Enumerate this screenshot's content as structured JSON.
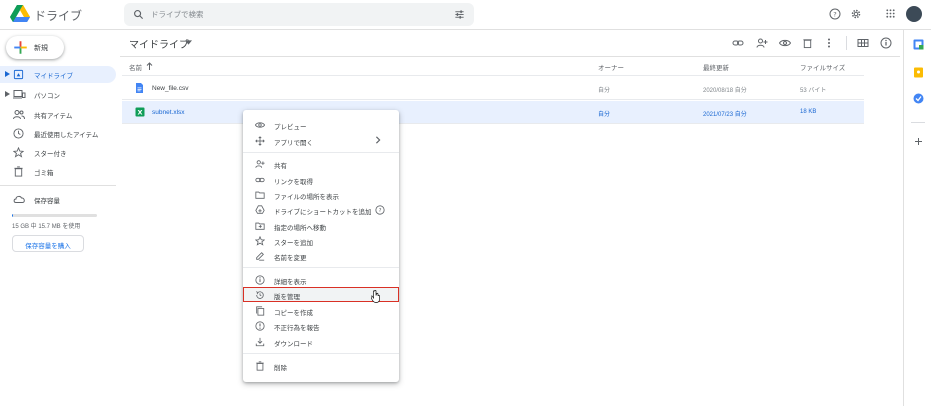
{
  "header": {
    "app_title": "ドライブ",
    "search_placeholder": "ドライブで検索"
  },
  "sidebar": {
    "new_label": "新規",
    "items": [
      {
        "label": "マイドライブ"
      },
      {
        "label": "パソコン"
      },
      {
        "label": "共有アイテム"
      },
      {
        "label": "最近使用したアイテム"
      },
      {
        "label": "スター付き"
      },
      {
        "label": "ゴミ箱"
      },
      {
        "label": "保存容量"
      }
    ],
    "storage_text": "15 GB 中 15.7 MB を使用",
    "storage_used_fraction": 0.001,
    "buy_storage_label": "保存容量を購入"
  },
  "main": {
    "breadcrumb": "マイドライブ",
    "columns": {
      "name": "名前",
      "owner": "オーナー",
      "modified": "最終更新",
      "size": "ファイルサイズ"
    },
    "files": [
      {
        "name": "New_file.csv",
        "owner": "自分",
        "modified": "2020/08/18 自分",
        "size": "53 バイト",
        "icon": "doc-icon"
      },
      {
        "name": "subnet.xlsx",
        "owner": "自分",
        "modified": "2021/07/23 自分",
        "size": "18 KB",
        "icon": "sheets-icon"
      }
    ]
  },
  "context_menu": {
    "items": [
      {
        "label": "プレビュー",
        "icon": "eye-icon"
      },
      {
        "label": "アプリで開く",
        "icon": "move-icon"
      },
      {
        "label": "共有",
        "icon": "person-add-icon"
      },
      {
        "label": "リンクを取得",
        "icon": "link-icon"
      },
      {
        "label": "ファイルの場所を表示",
        "icon": "folder-icon"
      },
      {
        "label": "ドライブにショートカットを追加",
        "icon": "shortcut-icon"
      },
      {
        "label": "指定の場所へ移動",
        "icon": "move-to-icon"
      },
      {
        "label": "スターを追加",
        "icon": "star-icon"
      },
      {
        "label": "名前を変更",
        "icon": "edit-icon"
      },
      {
        "label": "詳細を表示",
        "icon": "info-icon"
      },
      {
        "label": "版を管理",
        "icon": "history-icon"
      },
      {
        "label": "コピーを作成",
        "icon": "copy-icon"
      },
      {
        "label": "不正行為を報告",
        "icon": "report-icon"
      },
      {
        "label": "ダウンロード",
        "icon": "download-icon"
      },
      {
        "label": "削除",
        "icon": "trash-icon"
      }
    ]
  },
  "colors": {
    "accent": "#1a73e8",
    "selected_bg": "#e8f0fe",
    "highlight_border": "#d93025"
  }
}
